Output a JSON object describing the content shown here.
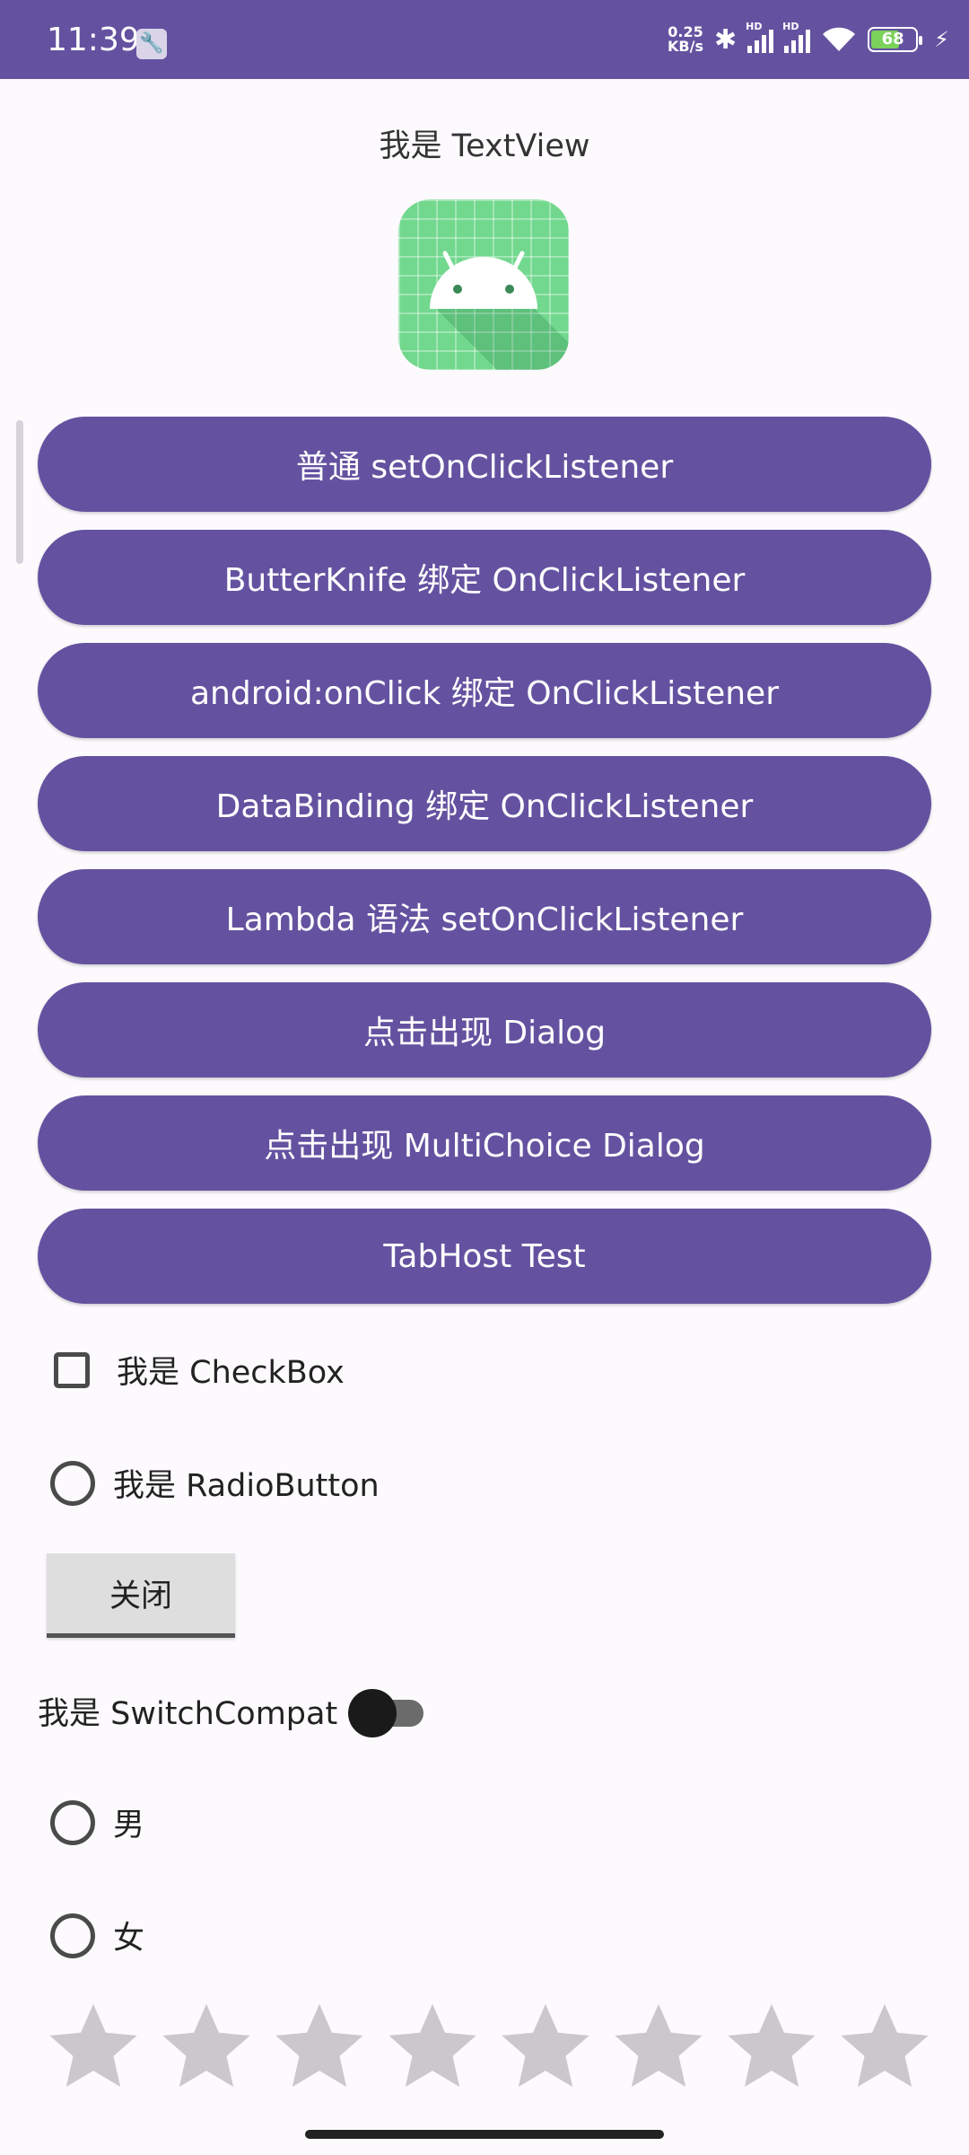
{
  "status_bar": {
    "time": "11:39",
    "net_speed_value": "0.25",
    "net_speed_unit": "KB/s",
    "sig1_label": "HD",
    "sig2_label": "HD",
    "battery_level": "68",
    "bluetooth_icon": "✱",
    "wifi_icon": "wifi",
    "charging_icon": "⚡",
    "colors": {
      "background": "#6452a0",
      "battery_fill": "#7bd25a"
    }
  },
  "textview": "我是 TextView",
  "app_icon": {
    "name": "android-icon",
    "color": "#72d88e"
  },
  "buttons": [
    "普通 setOnClickListener",
    "ButterKnife 绑定 OnClickListener",
    "android:onClick 绑定 OnClickListener",
    "DataBinding 绑定 OnClickListener",
    "Lambda 语法 setOnClickListener",
    "点击出现 Dialog",
    "点击出现 MultiChoice Dialog",
    "TabHost Test"
  ],
  "checkbox": {
    "label": "我是 CheckBox",
    "checked": false
  },
  "radio_button": {
    "label": "我是 RadioButton",
    "checked": false
  },
  "close_button": "关闭",
  "switch": {
    "label": "我是 SwitchCompat",
    "on": false
  },
  "gender_radios": [
    {
      "label": "男",
      "checked": false
    },
    {
      "label": "女",
      "checked": false
    }
  ],
  "rating_bar": {
    "rating": 0,
    "max": 8,
    "color": "#cbc8cc"
  },
  "theme": {
    "accent": "#6452a0",
    "background": "#fcfafd"
  }
}
